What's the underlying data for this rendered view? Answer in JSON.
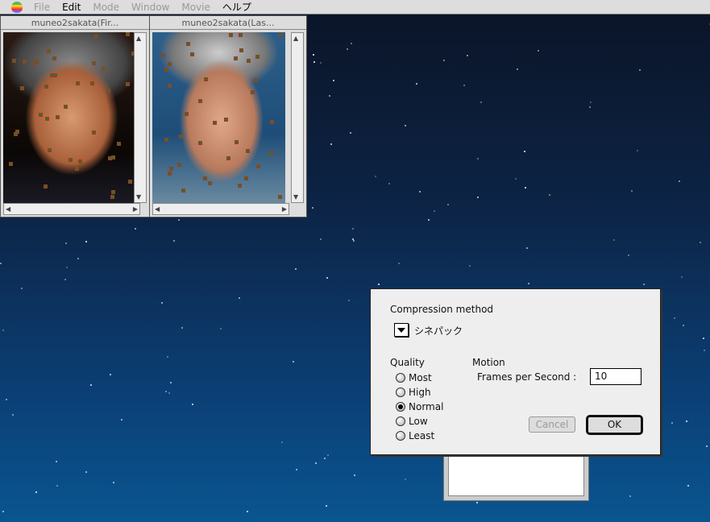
{
  "menubar": {
    "items": [
      {
        "label": "File",
        "enabled": false
      },
      {
        "label": "Edit",
        "enabled": true
      },
      {
        "label": "Mode",
        "enabled": false
      },
      {
        "label": "Window",
        "enabled": false
      },
      {
        "label": "Movie",
        "enabled": false
      },
      {
        "label": "ヘルプ",
        "enabled": true
      }
    ]
  },
  "windows": [
    {
      "title": "muneo2sakata(Fir..."
    },
    {
      "title": "muneo2sakata(Las..."
    }
  ],
  "dialog": {
    "compression_label": "Compression method",
    "compression_value": "シネパック",
    "quality_label": "Quality",
    "quality_options": [
      "Most",
      "High",
      "Normal",
      "Low",
      "Least"
    ],
    "quality_selected": "Normal",
    "motion_label": "Motion",
    "fps_label": "Frames per Second :",
    "fps_value": "10",
    "cancel_label": "Cancel",
    "ok_label": "OK"
  }
}
